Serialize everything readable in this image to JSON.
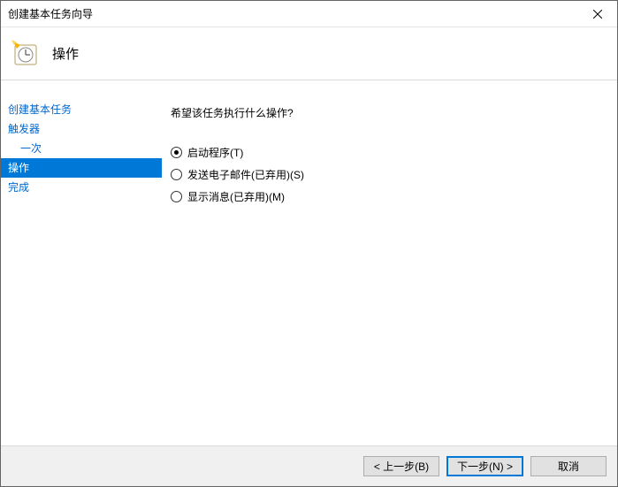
{
  "window": {
    "title": "创建基本任务向导"
  },
  "header": {
    "title": "操作"
  },
  "sidebar": {
    "items": [
      {
        "label": "创建基本任务",
        "indent": false,
        "selected": false
      },
      {
        "label": "触发器",
        "indent": false,
        "selected": false
      },
      {
        "label": "一次",
        "indent": true,
        "selected": false
      },
      {
        "label": "操作",
        "indent": false,
        "selected": true
      },
      {
        "label": "完成",
        "indent": false,
        "selected": false
      }
    ]
  },
  "main": {
    "prompt": "希望该任务执行什么操作?",
    "options": [
      {
        "label": "启动程序(T)",
        "checked": true
      },
      {
        "label": "发送电子邮件(已弃用)(S)",
        "checked": false
      },
      {
        "label": "显示消息(已弃用)(M)",
        "checked": false
      }
    ]
  },
  "footer": {
    "back": "< 上一步(B)",
    "next": "下一步(N) >",
    "cancel": "取消"
  }
}
